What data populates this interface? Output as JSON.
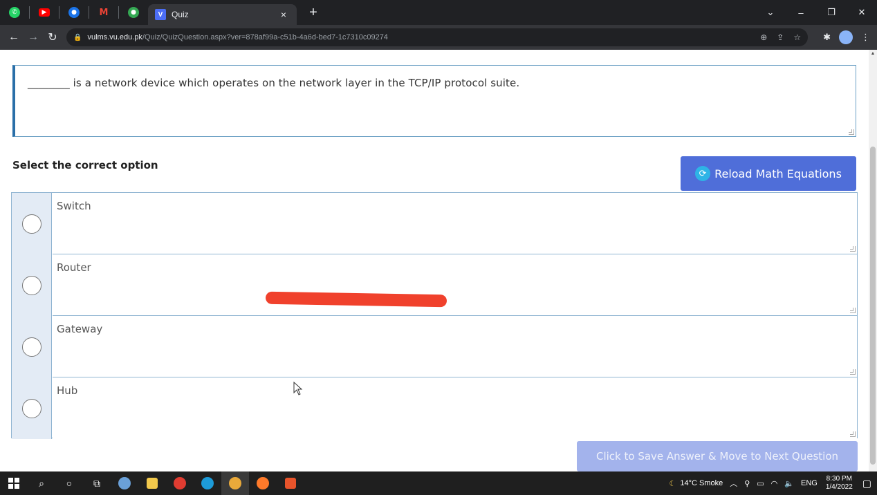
{
  "browser": {
    "tab_title": "Quiz",
    "tab_close": "×",
    "new_tab": "+",
    "url_host": "vulms.vu.edu.pk",
    "url_path": "/Quiz/QuizQuestion.aspx?ver=878af99a-c51b-4a6d-bed7-1c7310c09274",
    "window_minimize": "–",
    "window_restore": "❐",
    "window_close": "✕",
    "tab_menu": "⌄"
  },
  "page": {
    "question_text": "________ is a network device which operates on the network layer in the TCP/IP protocol suite.",
    "select_label": "Select the correct option",
    "reload_button": "Reload Math Equations",
    "save_button": "Click to Save Answer & Move to Next Question",
    "options": [
      {
        "label": "Switch"
      },
      {
        "label": "Router"
      },
      {
        "label": "Gateway"
      },
      {
        "label": "Hub"
      }
    ]
  },
  "taskbar": {
    "weather": "14°C  Smoke",
    "language": "ENG",
    "time": "8:30 PM",
    "date": "1/4/2022"
  },
  "colors": {
    "accent_button": "#4f6ed9",
    "disabled_button": "#a3b3ec",
    "option_border": "#8fb4d2",
    "question_border": "#2a6fa8",
    "annotation_red": "#f0412c"
  }
}
